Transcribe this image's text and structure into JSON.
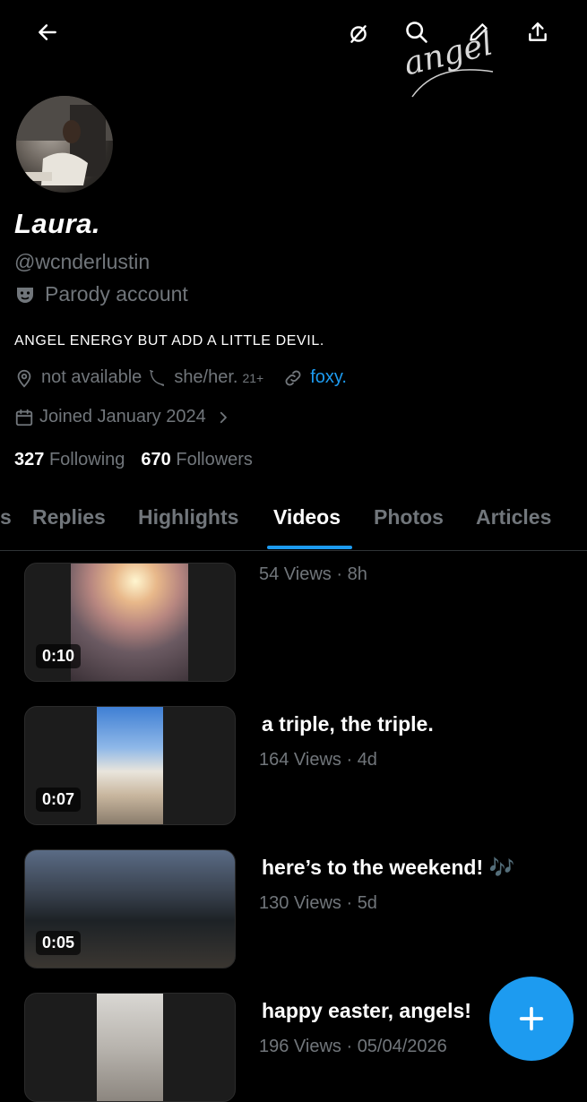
{
  "header": {
    "back_icon": "arrow-left-icon",
    "actions": [
      "no-sync-icon",
      "search-icon",
      "pencil-icon",
      "share-icon"
    ],
    "overlay_script": "angel"
  },
  "profile": {
    "display_name": "Laura.",
    "handle": "@wcnderlustin",
    "parody_label": "Parody account",
    "bio": "ANGEL ENERGY BUT ADD A LITTLE DEVIL.",
    "location": "not available",
    "pronouns": "she/her.",
    "age_tag": "21+",
    "link_text": "foxy.",
    "joined": "Joined January 2024",
    "following_count": "327",
    "following_label": "Following",
    "followers_count": "670",
    "followers_label": "Followers"
  },
  "tabs": {
    "partial_left": "s",
    "items": [
      "Replies",
      "Highlights",
      "Videos",
      "Photos",
      "Articles"
    ],
    "active": "Videos"
  },
  "videos": [
    {
      "title": "",
      "views": "54 Views · 8h",
      "duration": "0:10"
    },
    {
      "title": "a triple, the triple.",
      "views": "164 Views · 4d",
      "duration": "0:07"
    },
    {
      "title": "here’s to the weekend! 🎶",
      "views": "130 Views · 5d",
      "duration": "0:05"
    },
    {
      "title": "happy easter, angels!",
      "views": "196 Views · 05/04/2026",
      "duration": ""
    }
  ],
  "colors": {
    "accent": "#1d9bf0",
    "muted": "#71767b",
    "background": "#000000"
  },
  "fab": {
    "icon": "plus-icon"
  }
}
